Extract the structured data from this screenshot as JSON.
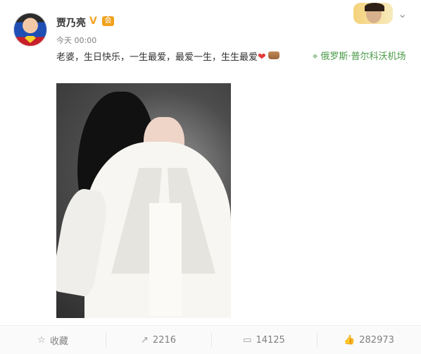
{
  "user": {
    "name": "贾乃亮",
    "verified_mark": "V",
    "vip_badge": "会",
    "time": "今天 00:00"
  },
  "post": {
    "text": "老婆，生日快乐，一生最爱，最爱一生，生生最爱",
    "emoji_heart": "❤",
    "location": "俄罗斯·普尔科沃机场"
  },
  "actions": {
    "favorite": "收藏",
    "repost": "2216",
    "comment": "14125",
    "like": "282973"
  },
  "icons": {
    "favorite": "☆",
    "repost": "↗",
    "comment": "▭",
    "like": "👍"
  },
  "colors": {
    "verified": "#f3a32a",
    "vip": "#f0a21f",
    "location": "#4a9b48",
    "heart": "#e43b3b"
  }
}
